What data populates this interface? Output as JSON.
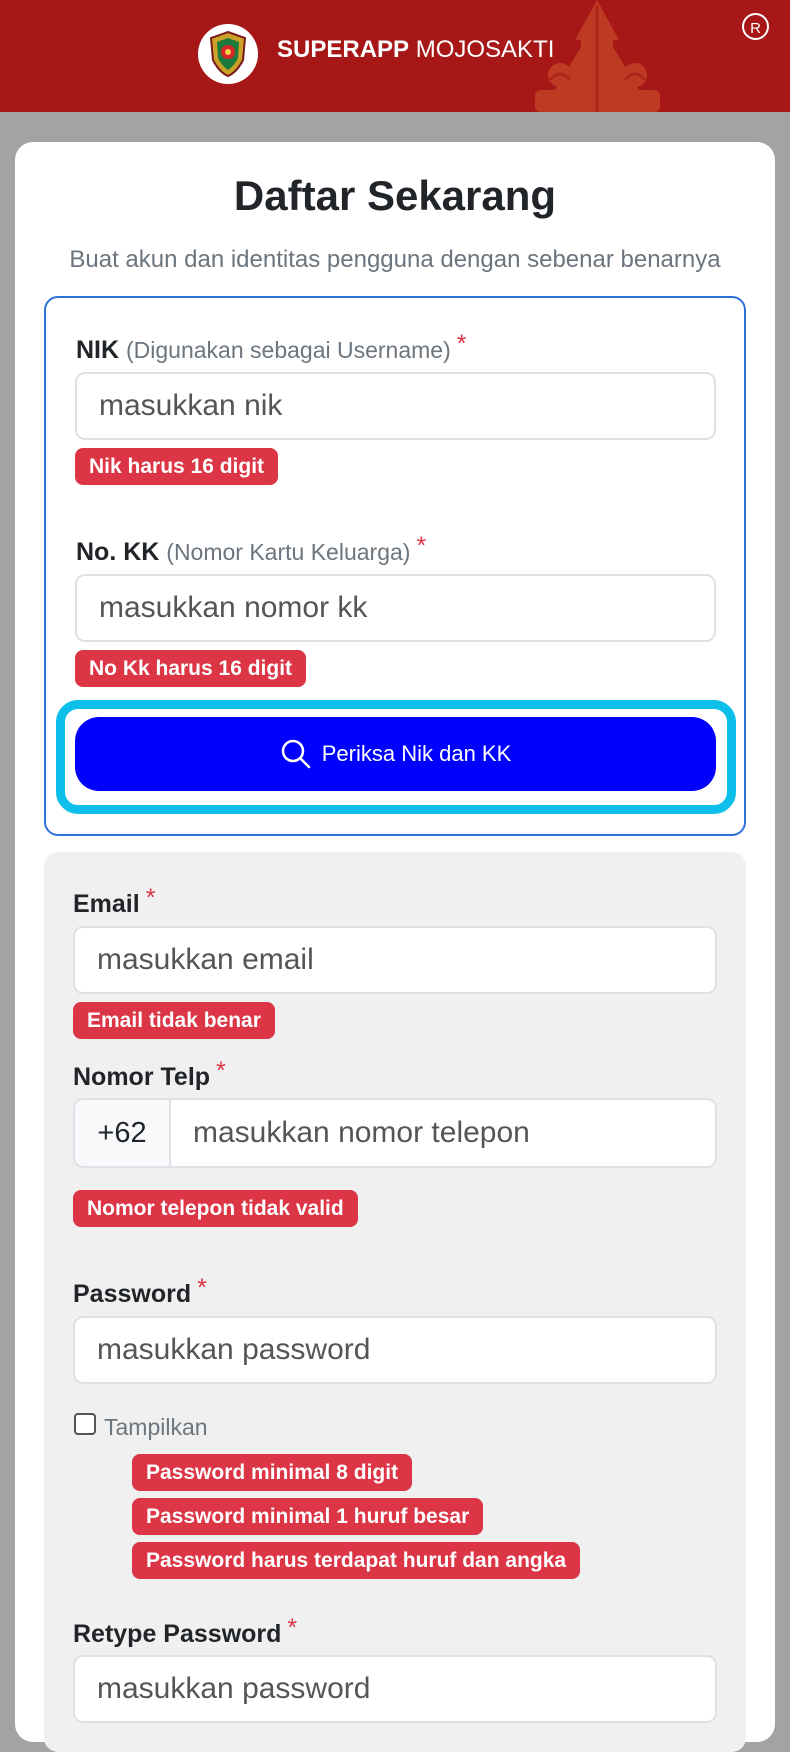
{
  "header": {
    "app_name_bold": "SUPERAPP",
    "app_name_rest": " MOJOSAKTI",
    "registered_mark": "R",
    "colors": {
      "bar": "#a71717"
    }
  },
  "form": {
    "title": "Daftar Sekarang",
    "subtitle": "Buat akun dan identitas pengguna dengan sebenar benarnya",
    "required_mark": "*",
    "nik": {
      "label": "NIK",
      "hint": "(Digunakan sebagai Username)",
      "placeholder": "masukkan nik",
      "error": "Nik harus 16 digit"
    },
    "kk": {
      "label": "No. KK",
      "hint": "(Nomor Kartu Keluarga)",
      "placeholder": "masukkan nomor kk",
      "error": "No Kk harus 16 digit"
    },
    "check_button": {
      "label": "Periksa Nik dan KK",
      "icon": "search-icon"
    },
    "email": {
      "label": "Email",
      "placeholder": "masukkan email",
      "error": "Email tidak benar"
    },
    "phone": {
      "label": "Nomor Telp",
      "prefix": "+62",
      "placeholder": "masukkan nomor telepon",
      "error": "Nomor telepon tidak valid"
    },
    "password": {
      "label": "Password",
      "placeholder": "masukkan password",
      "show_label": "Tampilkan",
      "show_checked": false,
      "errors": [
        "Password minimal 8 digit",
        "Password minimal 1 huruf besar",
        "Password harus terdapat huruf dan angka"
      ]
    },
    "retype_password": {
      "label": "Retype Password",
      "placeholder": "masukkan password"
    }
  },
  "colors": {
    "error": "#dc3545",
    "primary_button": "#0000ff",
    "focus_ring": "#0dbfea"
  }
}
